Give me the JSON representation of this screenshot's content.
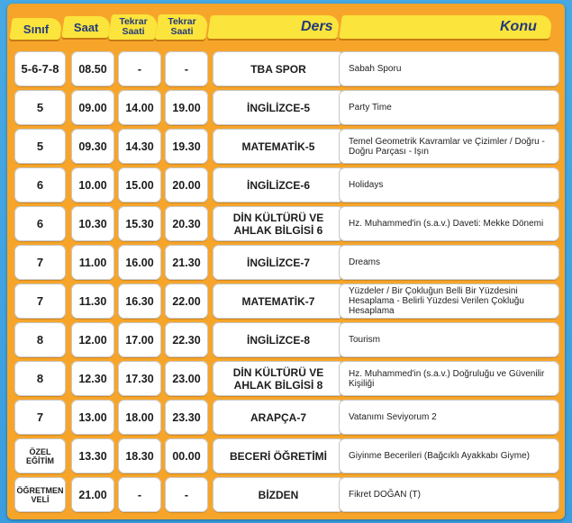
{
  "header": {
    "sinif": "Sınıf",
    "saat": "Saat",
    "tekrar1": "Tekrar Saati",
    "tekrar2": "Tekrar Saati",
    "ders": "Ders",
    "konu": "Konu"
  },
  "rows": [
    {
      "sinif": "5-6-7-8",
      "saat": "08.50",
      "tekrar1": "-",
      "tekrar2": "-",
      "ders": "TBA SPOR",
      "konu": "Sabah Sporu"
    },
    {
      "sinif": "5",
      "saat": "09.00",
      "tekrar1": "14.00",
      "tekrar2": "19.00",
      "ders": "İNGİLİZCE-5",
      "konu": "Party Time"
    },
    {
      "sinif": "5",
      "saat": "09.30",
      "tekrar1": "14.30",
      "tekrar2": "19.30",
      "ders": "MATEMATİK-5",
      "konu": "Temel Geometrik Kavramlar ve Çizimler / Doğru - Doğru Parçası - Işın"
    },
    {
      "sinif": "6",
      "saat": "10.00",
      "tekrar1": "15.00",
      "tekrar2": "20.00",
      "ders": "İNGİLİZCE-6",
      "konu": "Holidays"
    },
    {
      "sinif": "6",
      "saat": "10.30",
      "tekrar1": "15.30",
      "tekrar2": "20.30",
      "ders": "DİN KÜLTÜRÜ VE AHLAK BİLGİSİ 6",
      "konu": "Hz. Muhammed'in (s.a.v.) Daveti: Mekke Dönemi"
    },
    {
      "sinif": "7",
      "saat": "11.00",
      "tekrar1": "16.00",
      "tekrar2": "21.30",
      "ders": "İNGİLİZCE-7",
      "konu": "Dreams"
    },
    {
      "sinif": "7",
      "saat": "11.30",
      "tekrar1": "16.30",
      "tekrar2": "22.00",
      "ders": "MATEMATİK-7",
      "konu": "Yüzdeler / Bir Çokluğun Belli Bir Yüzdesini Hesaplama - Belirli Yüzdesi Verilen Çokluğu Hesaplama"
    },
    {
      "sinif": "8",
      "saat": "12.00",
      "tekrar1": "17.00",
      "tekrar2": "22.30",
      "ders": "İNGİLİZCE-8",
      "konu": "Tourism"
    },
    {
      "sinif": "8",
      "saat": "12.30",
      "tekrar1": "17.30",
      "tekrar2": "23.00",
      "ders": "DİN KÜLTÜRÜ VE AHLAK BİLGİSİ 8",
      "konu": "Hz. Muhammed'in (s.a.v.) Doğruluğu ve Güvenilir Kişiliği"
    },
    {
      "sinif": "7",
      "saat": "13.00",
      "tekrar1": "18.00",
      "tekrar2": "23.30",
      "ders": "ARAPÇA-7",
      "konu": "Vatanımı Seviyorum 2"
    },
    {
      "sinif": "ÖZEL EĞİTİM",
      "saat": "13.30",
      "tekrar1": "18.30",
      "tekrar2": "00.00",
      "ders": "BECERİ ÖĞRETİMİ",
      "konu": "Giyinme Becerileri (Bağcıklı Ayakkabı Giyme)"
    },
    {
      "sinif": "ÖĞRETMEN VELİ",
      "saat": "21.00",
      "tekrar1": "-",
      "tekrar2": "-",
      "ders": "BİZDEN",
      "konu": "Fikret DOĞAN (T)"
    }
  ]
}
